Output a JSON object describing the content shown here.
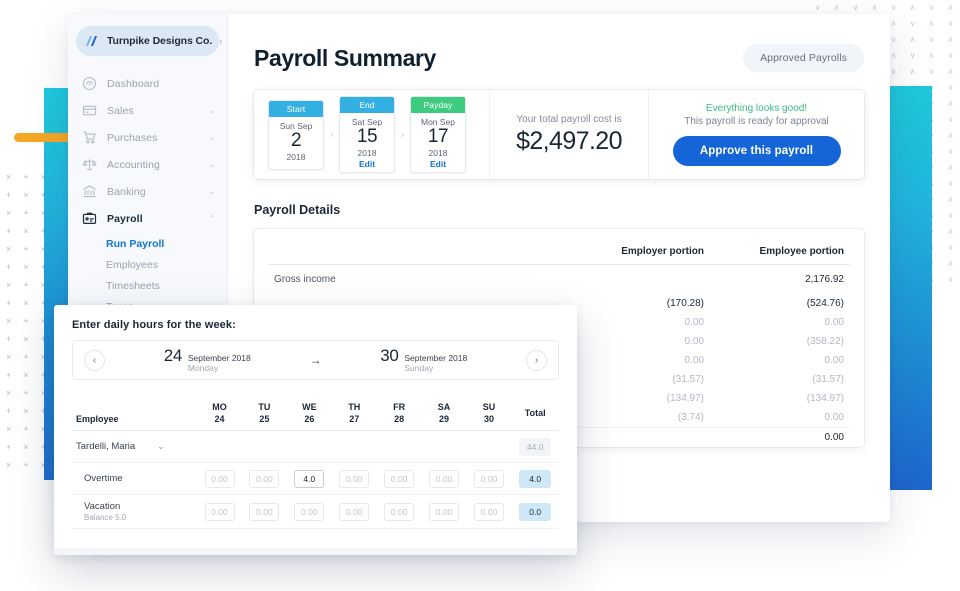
{
  "brand": {
    "name": "Turnpike Designs Co.",
    "caret": "›"
  },
  "sidebar": {
    "items": [
      {
        "label": "Dashboard",
        "icon": "dashboard-icon",
        "expandable": false
      },
      {
        "label": "Sales",
        "icon": "card-icon",
        "expandable": true,
        "chevron": "⌄"
      },
      {
        "label": "Purchases",
        "icon": "cart-icon",
        "expandable": true,
        "chevron": "⌄"
      },
      {
        "label": "Accounting",
        "icon": "scales-icon",
        "expandable": true,
        "chevron": "⌄"
      },
      {
        "label": "Banking",
        "icon": "bank-icon",
        "expandable": true,
        "chevron": "⌄"
      },
      {
        "label": "Payroll",
        "icon": "payroll-icon",
        "expandable": true,
        "chevron": "⌃",
        "active": true
      }
    ],
    "subitems": [
      {
        "label": "Run Payroll",
        "active": true
      },
      {
        "label": "Employees",
        "active": false
      },
      {
        "label": "Timesheets",
        "active": false
      },
      {
        "label": "Taxes",
        "active": false
      }
    ]
  },
  "header": {
    "title": "Payroll Summary",
    "approved_payrolls_label": "Approved Payrolls"
  },
  "summary": {
    "dates": [
      {
        "kind": "Start",
        "head_color": "#33b0e2",
        "dow": "Sun Sep",
        "day": "2",
        "year": "2018",
        "edit": ""
      },
      {
        "kind": "End",
        "head_color": "#33b0e2",
        "dow": "Sat Sep",
        "day": "15",
        "year": "2018",
        "edit": "Edit"
      },
      {
        "kind": "Payday",
        "head_color": "#3ccb7f",
        "dow": "Mon Sep",
        "day": "17",
        "year": "2018",
        "edit": "Edit"
      }
    ],
    "arrow": "›",
    "total_label": "Your total payroll cost is",
    "total_value": "$2,497.20",
    "status_good": "Everything looks good!",
    "status_sub": "This payroll is ready for approval",
    "approve_label": "Approve this payroll"
  },
  "details": {
    "title": "Payroll Details",
    "columns": [
      "",
      "Employer portion",
      "Employee portion"
    ],
    "rows": [
      {
        "label": "Gross income",
        "employer": "",
        "employee": "2,176.92",
        "style": "gross"
      },
      {
        "label": "",
        "employer": "(170.28)",
        "employee": "(524.76)",
        "style": "normal"
      },
      {
        "label": "",
        "employer": "0.00",
        "employee": "0.00",
        "style": "muted"
      },
      {
        "label": "",
        "employer": "0.00",
        "employee": "(358.22)",
        "style": "muted"
      },
      {
        "label": "",
        "employer": "0.00",
        "employee": "0.00",
        "style": "muted"
      },
      {
        "label": "",
        "employer": "(31.57)",
        "employee": "(31.57)",
        "style": "muted"
      },
      {
        "label": "",
        "employer": "(134.97)",
        "employee": "(134.97)",
        "style": "muted"
      },
      {
        "label": "",
        "employer": "(3.74)",
        "employee": "0.00",
        "style": "muted"
      },
      {
        "label": "",
        "employer": "",
        "employee": "0.00",
        "style": "rule"
      }
    ]
  },
  "timesheet": {
    "title": "Enter daily hours for the week:",
    "prev_icon": "‹",
    "next_icon": "›",
    "mid_arrow": "→",
    "range_start": {
      "day": "24",
      "month": "September 2018",
      "dow": "Monday"
    },
    "range_end": {
      "day": "30",
      "month": "September 2018",
      "dow": "Sunday"
    },
    "columns": [
      {
        "dow": "MO",
        "num": "24"
      },
      {
        "dow": "TU",
        "num": "25"
      },
      {
        "dow": "WE",
        "num": "26"
      },
      {
        "dow": "TH",
        "num": "27"
      },
      {
        "dow": "FR",
        "num": "28"
      },
      {
        "dow": "SA",
        "num": "29"
      },
      {
        "dow": "SU",
        "num": "30"
      }
    ],
    "employee_header": "Employee",
    "total_header": "Total",
    "employee": {
      "name": "Tardelli, Maria",
      "caret": "⌄",
      "total": "44.0"
    },
    "rows": [
      {
        "label": "Overtime",
        "sub": "",
        "values": [
          "0.00",
          "0.00",
          "4.0",
          "0.00",
          "0.00",
          "0.00",
          "0.00"
        ],
        "filled": [
          false,
          false,
          true,
          false,
          false,
          false,
          false
        ],
        "total": "4.0"
      },
      {
        "label": "Vacation",
        "sub": "Balance 5.0",
        "values": [
          "0.00",
          "0.00",
          "0.00",
          "0.00",
          "0.00",
          "0.00",
          "0.00"
        ],
        "filled": [
          false,
          false,
          false,
          false,
          false,
          false,
          false
        ],
        "total": "0.0"
      }
    ]
  },
  "decor": {
    "accent_cyan": "#1fc8db",
    "accent_blue": "#1e65cd",
    "accent_orange": "#f5a623",
    "pattern_left_glyphs": "×+",
    "pattern_right_glyphs": "∨∧"
  }
}
